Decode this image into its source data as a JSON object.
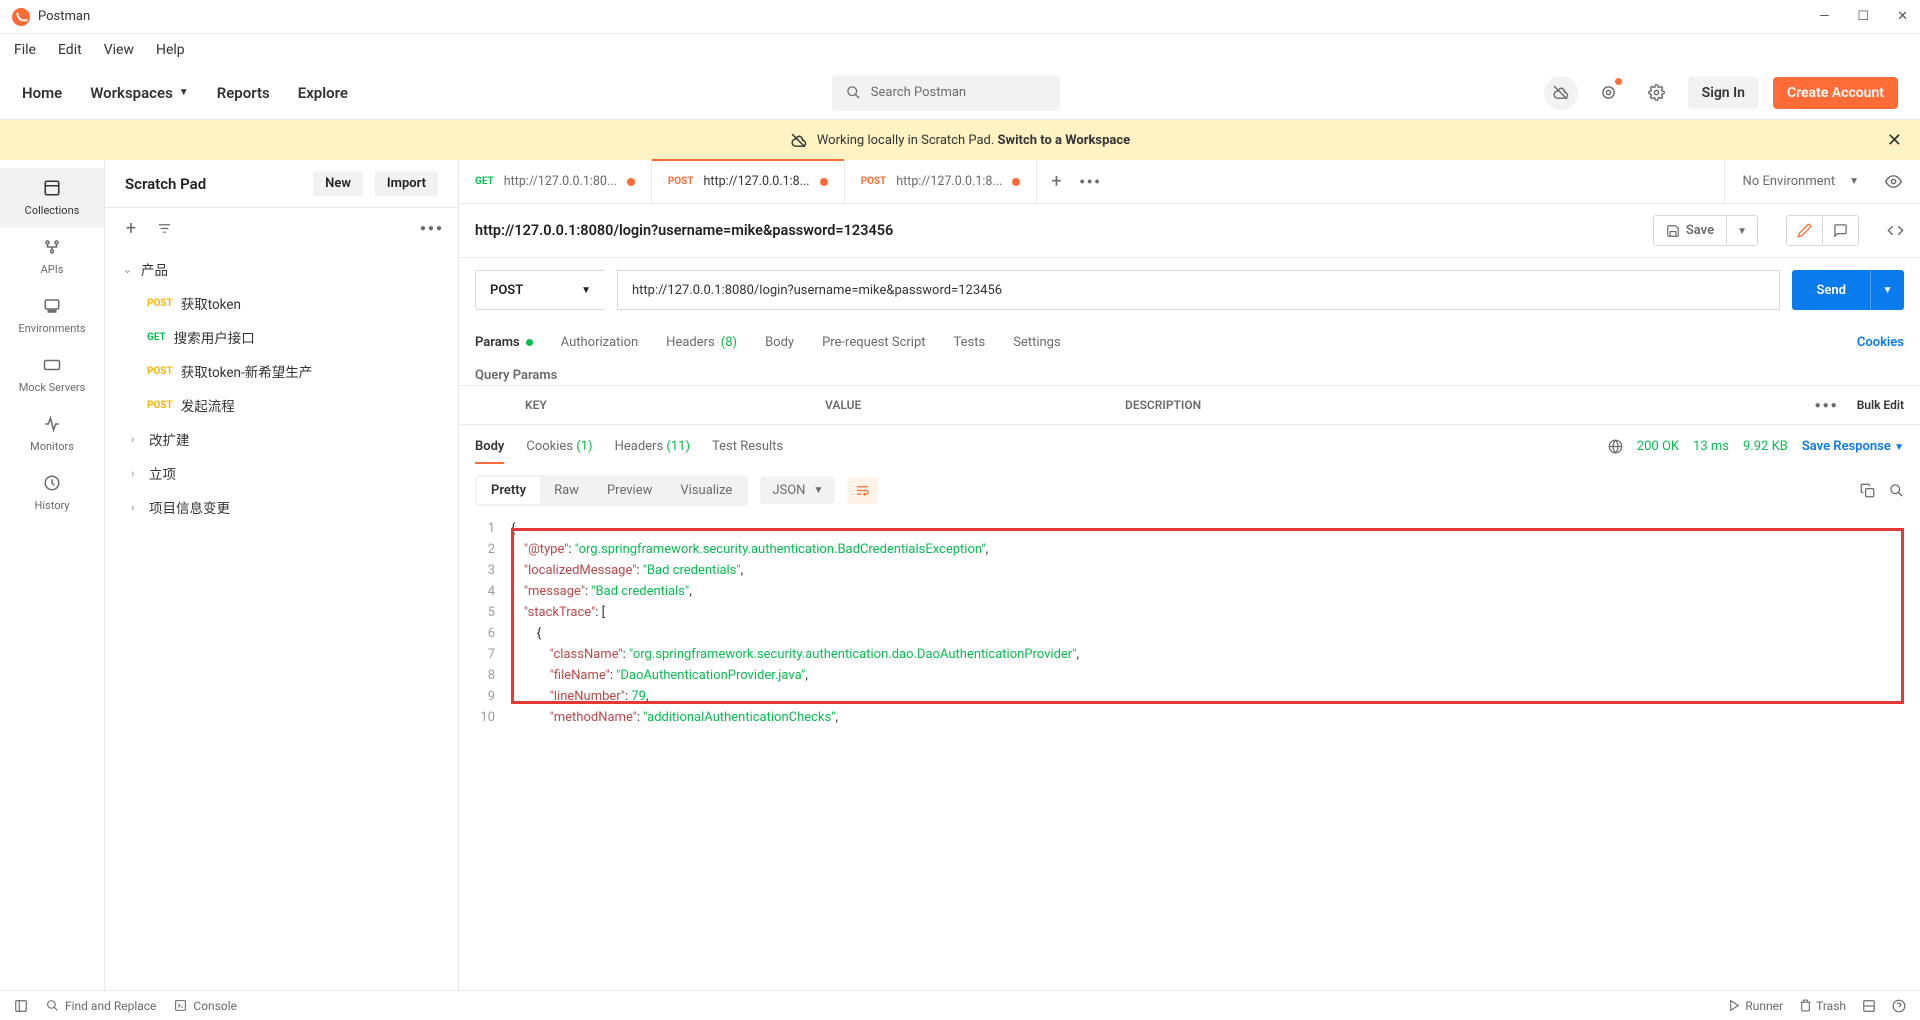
{
  "app": {
    "name": "Postman"
  },
  "menu": {
    "file": "File",
    "edit": "Edit",
    "view": "View",
    "help": "Help"
  },
  "nav": {
    "home": "Home",
    "workspaces": "Workspaces",
    "reports": "Reports",
    "explore": "Explore"
  },
  "search": {
    "placeholder": "Search Postman"
  },
  "auth": {
    "signin": "Sign In",
    "create": "Create Account"
  },
  "banner": {
    "text": "Working locally in Scratch Pad.",
    "link": "Switch to a Workspace"
  },
  "sidebar": {
    "title": "Scratch Pad",
    "new": "New",
    "import": "Import",
    "rail": {
      "collections": "Collections",
      "apis": "APIs",
      "environments": "Environments",
      "mock": "Mock Servers",
      "monitors": "Monitors",
      "history": "History"
    },
    "tree": {
      "root": "产品",
      "items": [
        {
          "method": "POST",
          "label": "获取token"
        },
        {
          "method": "GET",
          "label": "搜索用户接口"
        },
        {
          "method": "POST",
          "label": "获取token-新希望生产"
        },
        {
          "method": "POST",
          "label": "发起流程"
        }
      ],
      "folders": [
        "改扩建",
        "立项",
        "项目信息变更"
      ]
    }
  },
  "tabs": [
    {
      "method": "GET",
      "label": "http://127.0.0.1:80...",
      "dirty": true,
      "active": false
    },
    {
      "method": "POST",
      "label": "http://127.0.0.1:8...",
      "dirty": true,
      "active": true
    },
    {
      "method": "POST",
      "label": "http://127.0.0.1:8...",
      "dirty": true,
      "active": false
    }
  ],
  "env": {
    "label": "No Environment"
  },
  "request": {
    "title": "http://127.0.0.1:8080/login?username=mike&password=123456",
    "save": "Save",
    "method": "POST",
    "url": "http://127.0.0.1:8080/login?username=mike&password=123456",
    "send": "Send",
    "tabs": {
      "params": "Params",
      "auth": "Authorization",
      "headers": "Headers",
      "headersCount": "(8)",
      "body": "Body",
      "prereq": "Pre-request Script",
      "tests": "Tests",
      "settings": "Settings",
      "cookies": "Cookies"
    },
    "query": "Query Params",
    "cols": {
      "key": "KEY",
      "value": "VALUE",
      "desc": "DESCRIPTION",
      "bulk": "Bulk Edit"
    }
  },
  "response": {
    "tabs": {
      "body": "Body",
      "cookies": "Cookies",
      "cookiesCount": "(1)",
      "headers": "Headers",
      "headersCount": "(11)",
      "tests": "Test Results"
    },
    "status": {
      "code": "200 OK",
      "time": "13 ms",
      "size": "9.92 KB",
      "save": "Save Response"
    },
    "views": {
      "pretty": "Pretty",
      "raw": "Raw",
      "preview": "Preview",
      "visualize": "Visualize",
      "format": "JSON"
    },
    "json": {
      "l1": "{",
      "l2_k": "\"@type\"",
      "l2_v": "\"org.springframework.security.authentication.BadCredentialsException\"",
      "l3_k": "\"localizedMessage\"",
      "l3_v": "\"Bad credentials\"",
      "l4_k": "\"message\"",
      "l4_v": "\"Bad credentials\"",
      "l5_k": "\"stackTrace\"",
      "l7_k": "\"className\"",
      "l7_v": "\"org.springframework.security.authentication.dao.DaoAuthenticationProvider\"",
      "l8_k": "\"fileName\"",
      "l8_v": "\"DaoAuthenticationProvider.java\"",
      "l9_k": "\"lineNumber\"",
      "l9_v": "79",
      "l10_k": "\"methodName\"",
      "l10_v": "\"additionalAuthenticationChecks\""
    }
  },
  "footer": {
    "find": "Find and Replace",
    "console": "Console",
    "runner": "Runner",
    "trash": "Trash"
  }
}
